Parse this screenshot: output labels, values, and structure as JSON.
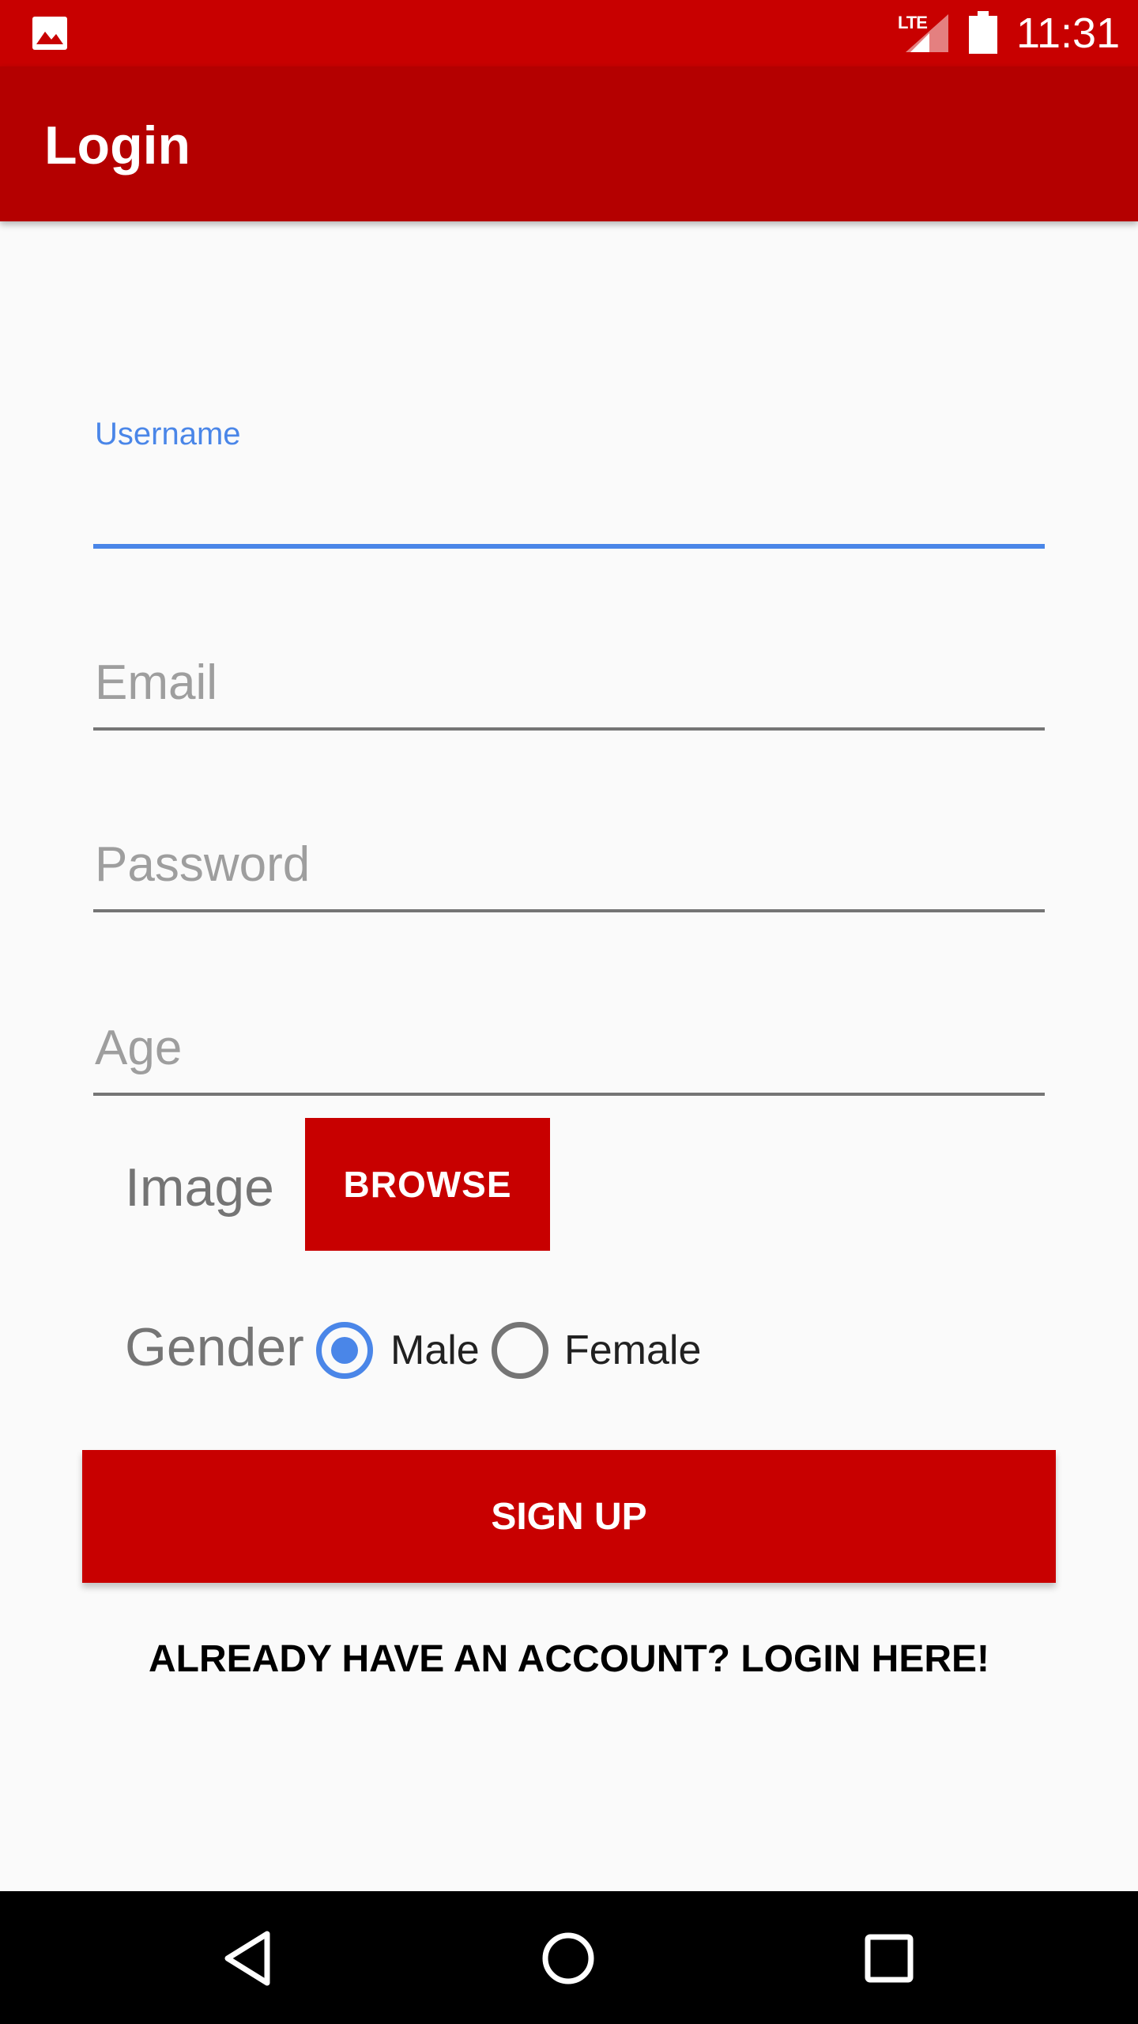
{
  "status_bar": {
    "network": "LTE",
    "time": "11:31",
    "icons": [
      "gallery-icon",
      "signal-icon",
      "battery-icon"
    ]
  },
  "app_bar": {
    "title": "Login"
  },
  "form": {
    "username": {
      "label": "Username",
      "value": ""
    },
    "email": {
      "placeholder": "Email",
      "value": ""
    },
    "password": {
      "placeholder": "Password",
      "value": ""
    },
    "age": {
      "placeholder": "Age",
      "value": ""
    },
    "image": {
      "label": "Image",
      "button_label": "BROWSE"
    },
    "gender": {
      "label": "Gender",
      "options": [
        "Male",
        "Female"
      ],
      "selected": "Male"
    },
    "signup_label": "SIGN UP",
    "login_link": "ALREADY HAVE AN ACCOUNT? LOGIN HERE!"
  },
  "nav_bar": {
    "icons": [
      "back-icon",
      "home-icon",
      "recents-icon"
    ]
  },
  "colors": {
    "status_bar": "#c80000",
    "app_bar": "#b40000",
    "accent": "#4a86e8",
    "button": "#c80000",
    "background": "#fafafa"
  }
}
